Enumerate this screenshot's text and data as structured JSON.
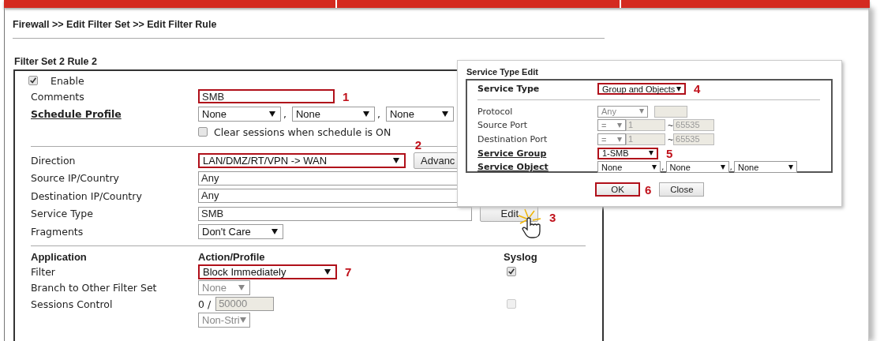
{
  "breadcrumb": "Firewall >> Edit Filter Set >> Edit Filter Rule",
  "section_title": "Filter Set 2 Rule 2",
  "enable": {
    "label": "Enable",
    "checked": true
  },
  "general": [
    {
      "kind": "text",
      "label": "Comments",
      "value": "SMB",
      "highlighted": true,
      "callout": "1"
    },
    {
      "kind": "selects",
      "label": "Schedule Profile",
      "link": true,
      "separator": ",",
      "options": [
        "None",
        "None",
        "None"
      ]
    },
    {
      "kind": "checkbox",
      "label": "Clear sessions when schedule is ON",
      "checked": false
    }
  ],
  "addressing": [
    {
      "kind": "select_button",
      "label": "Direction",
      "value": "LAN/DMZ/RT/VPN -> WAN",
      "highlighted": true,
      "callout": "2",
      "button": "Advanc"
    },
    {
      "kind": "text",
      "label": "Source IP/Country",
      "value": "Any"
    },
    {
      "kind": "text",
      "label": "Destination IP/Country",
      "value": "Any"
    },
    {
      "kind": "text_button",
      "label": "Service Type",
      "value": "SMB",
      "button": "Edit",
      "callout": "3"
    },
    {
      "kind": "select",
      "label": "Fragments",
      "value": "Don't Care"
    }
  ],
  "application": {
    "headers": [
      "Application",
      "Action/Profile",
      "Syslog"
    ],
    "rows": [
      {
        "kind": "select",
        "label": "Filter",
        "value": "Block Immediately",
        "highlighted": true,
        "callout": "7",
        "syslog": {
          "checked": true,
          "disabled": false
        }
      },
      {
        "kind": "select",
        "label": "Branch to Other Filter Set",
        "value": "None",
        "disabled": true
      },
      {
        "kind": "sessions",
        "label": "Sessions Control",
        "prefix": "0 /",
        "value": "50000",
        "disabled": true,
        "syslog": {
          "checked": false,
          "disabled": true
        }
      },
      {
        "kind": "select",
        "label": "",
        "value": "Non-Stri",
        "disabled": true
      }
    ]
  },
  "dialog": {
    "title": "Service Type Edit",
    "service_type": {
      "label": "Service Type",
      "value": "Group and Objects",
      "highlighted": true,
      "callout": "4"
    },
    "rows": [
      {
        "kind": "protocol",
        "label": "Protocol",
        "value": "Any"
      },
      {
        "kind": "port",
        "label": "Source Port",
        "op": "=",
        "from": "1",
        "tilde": "~",
        "to": "65535"
      },
      {
        "kind": "port",
        "label": "Destination Port",
        "op": "=",
        "from": "1",
        "tilde": "~",
        "to": "65535"
      },
      {
        "kind": "select",
        "label": "Service Group",
        "link": true,
        "value": "1-SMB",
        "highlighted": true,
        "callout": "5"
      },
      {
        "kind": "selects",
        "label": "Service Object",
        "link": true,
        "separator": ",",
        "options": [
          "None",
          "None",
          "None"
        ]
      }
    ],
    "buttons": [
      {
        "label": "OK",
        "highlighted": true,
        "callout": "6"
      },
      {
        "label": "Close",
        "highlighted": false
      }
    ]
  }
}
